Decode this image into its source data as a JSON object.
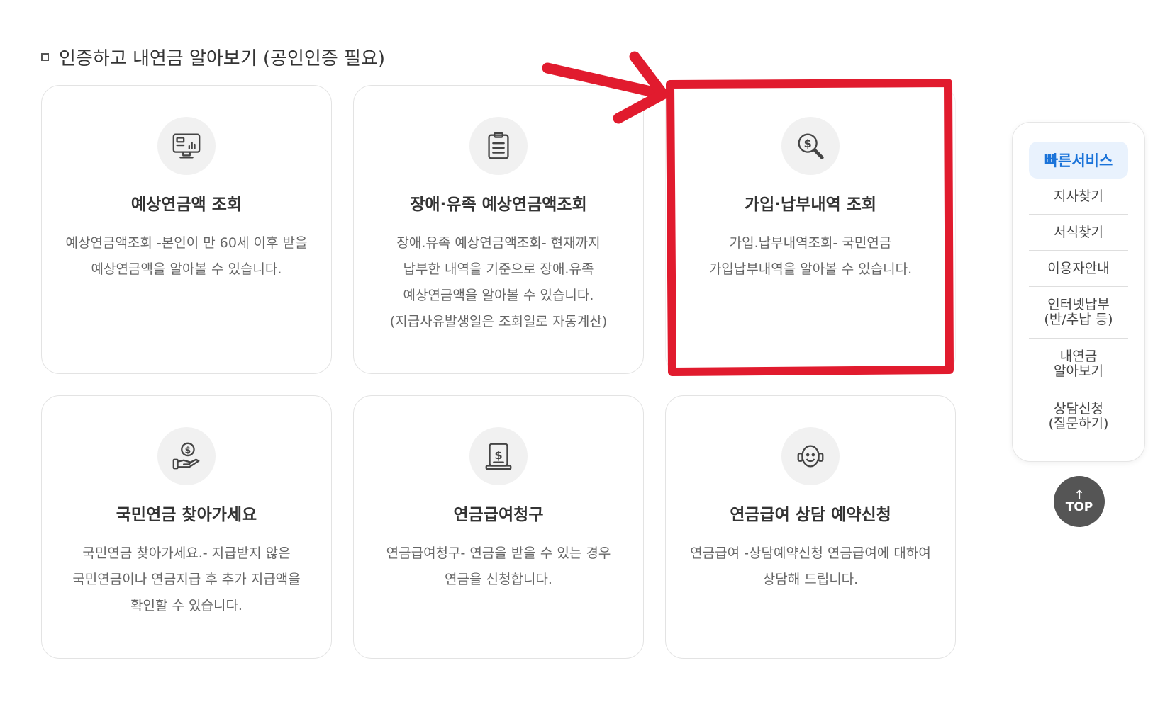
{
  "section_title": "인증하고 내연금 알아보기 (공인인증 필요)",
  "cards": [
    {
      "title": "예상연금액 조회",
      "desc": [
        "예상연금액조회 -본인이 만 60세 이후 받을",
        "예상연금액을 알아볼 수 있습니다."
      ],
      "icon": "monitor-chart-icon"
    },
    {
      "title": "장애·유족 예상연금액조회",
      "desc": [
        "장애.유족 예상연금액조회- 현재까지",
        "납부한 내역을 기준으로 장애.유족",
        "예상연금액을 알아볼 수 있습니다.",
        "(지급사유발생일은 조회일로 자동계산)"
      ],
      "icon": "clipboard-icon"
    },
    {
      "title": "가입·납부내역 조회",
      "desc": [
        "가입.납부내역조회- 국민연금",
        "가입납부내역을 알아볼 수 있습니다."
      ],
      "icon": "dollar-search-icon"
    },
    {
      "title": "국민연금 찾아가세요",
      "desc": [
        "국민연금 찾아가세요.- 지급받지 않은",
        "국민연금이나 연금지급 후 추가 지급액을",
        "확인할 수 있습니다."
      ],
      "icon": "hand-coin-icon"
    },
    {
      "title": "연금급여청구",
      "desc": [
        "연금급여청구- 연금을 받을 수 있는 경우",
        "연금을 신청합니다."
      ],
      "icon": "dollar-document-icon"
    },
    {
      "title": "연금급여 상담 예약신청",
      "desc": [
        "연금급여 -상담예약신청 연금급여에 대하여",
        "상담해 드립니다."
      ],
      "icon": "headset-icon"
    }
  ],
  "quick_service": {
    "title": "빠른서비스",
    "items": [
      {
        "line1": "지사찾기",
        "line2": ""
      },
      {
        "line1": "서식찾기",
        "line2": ""
      },
      {
        "line1": "이용자안내",
        "line2": ""
      },
      {
        "line1": "인터넷납부",
        "line2": "(반/추납 등)"
      },
      {
        "line1": "내연금",
        "line2": "알아보기"
      },
      {
        "line1": "상담신청",
        "line2": "(질문하기)"
      }
    ]
  },
  "top_button": {
    "arrow": "↑",
    "label": "TOP"
  },
  "colors": {
    "annotation": "#e11b2e",
    "quick_title": "#1a73d9",
    "quick_bg": "#e9f2fd",
    "top_bg": "#555555"
  }
}
